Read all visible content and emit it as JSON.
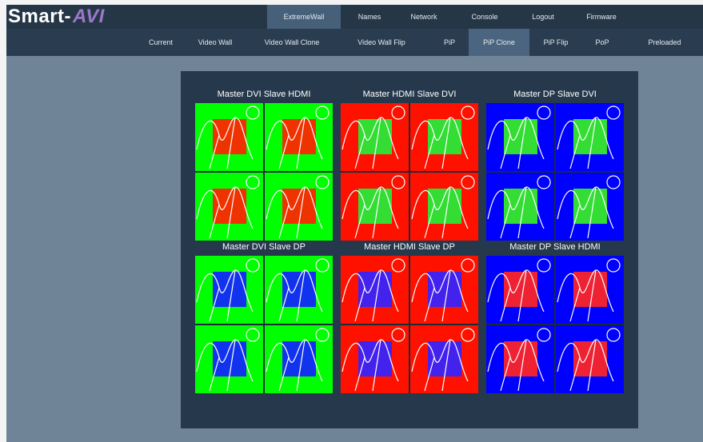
{
  "brand": {
    "name": "Smart-",
    "accent": "AVI"
  },
  "nav": {
    "items": [
      {
        "label": "ExtremeWall",
        "active": true
      },
      {
        "label": "Names",
        "active": false
      },
      {
        "label": "Network",
        "active": false
      },
      {
        "label": "Console",
        "active": false
      },
      {
        "label": "Logout",
        "active": false
      },
      {
        "label": "Firmware",
        "active": false
      }
    ]
  },
  "subnav": {
    "items": [
      {
        "label": "Current",
        "active": false
      },
      {
        "label": "Video Wall",
        "active": false
      },
      {
        "label": "Video Wall Clone",
        "active": false
      },
      {
        "label": "Video Wall Flip",
        "active": false
      },
      {
        "label": "PiP",
        "active": false
      },
      {
        "label": "PiP Clone",
        "active": true
      },
      {
        "label": "PiP Flip",
        "active": false
      },
      {
        "label": "PoP",
        "active": false
      },
      {
        "label": "Preloaded",
        "active": false
      }
    ]
  },
  "groups": [
    {
      "title": "Master DVI Slave HDMI",
      "bg": "#00ff00",
      "pip": "#ee3300"
    },
    {
      "title": "Master HDMI Slave DVI",
      "bg": "#ff1100",
      "pip": "#33dd33"
    },
    {
      "title": "Master DP Slave DVI",
      "bg": "#0000ff",
      "pip": "#33dd33"
    },
    {
      "title": "Master DVI Slave DP",
      "bg": "#00ff00",
      "pip": "#1133ee"
    },
    {
      "title": "Master HDMI Slave DP",
      "bg": "#ff1100",
      "pip": "#4422ee"
    },
    {
      "title": "Master DP Slave HDMI",
      "bg": "#0000ff",
      "pip": "#ee2233"
    }
  ],
  "colors": {
    "topbar": "#253647",
    "subbar": "#2a3d50",
    "page": "#6f8597",
    "canvas": "#26394c"
  },
  "icons": {
    "tile_art": "picture-icon"
  }
}
